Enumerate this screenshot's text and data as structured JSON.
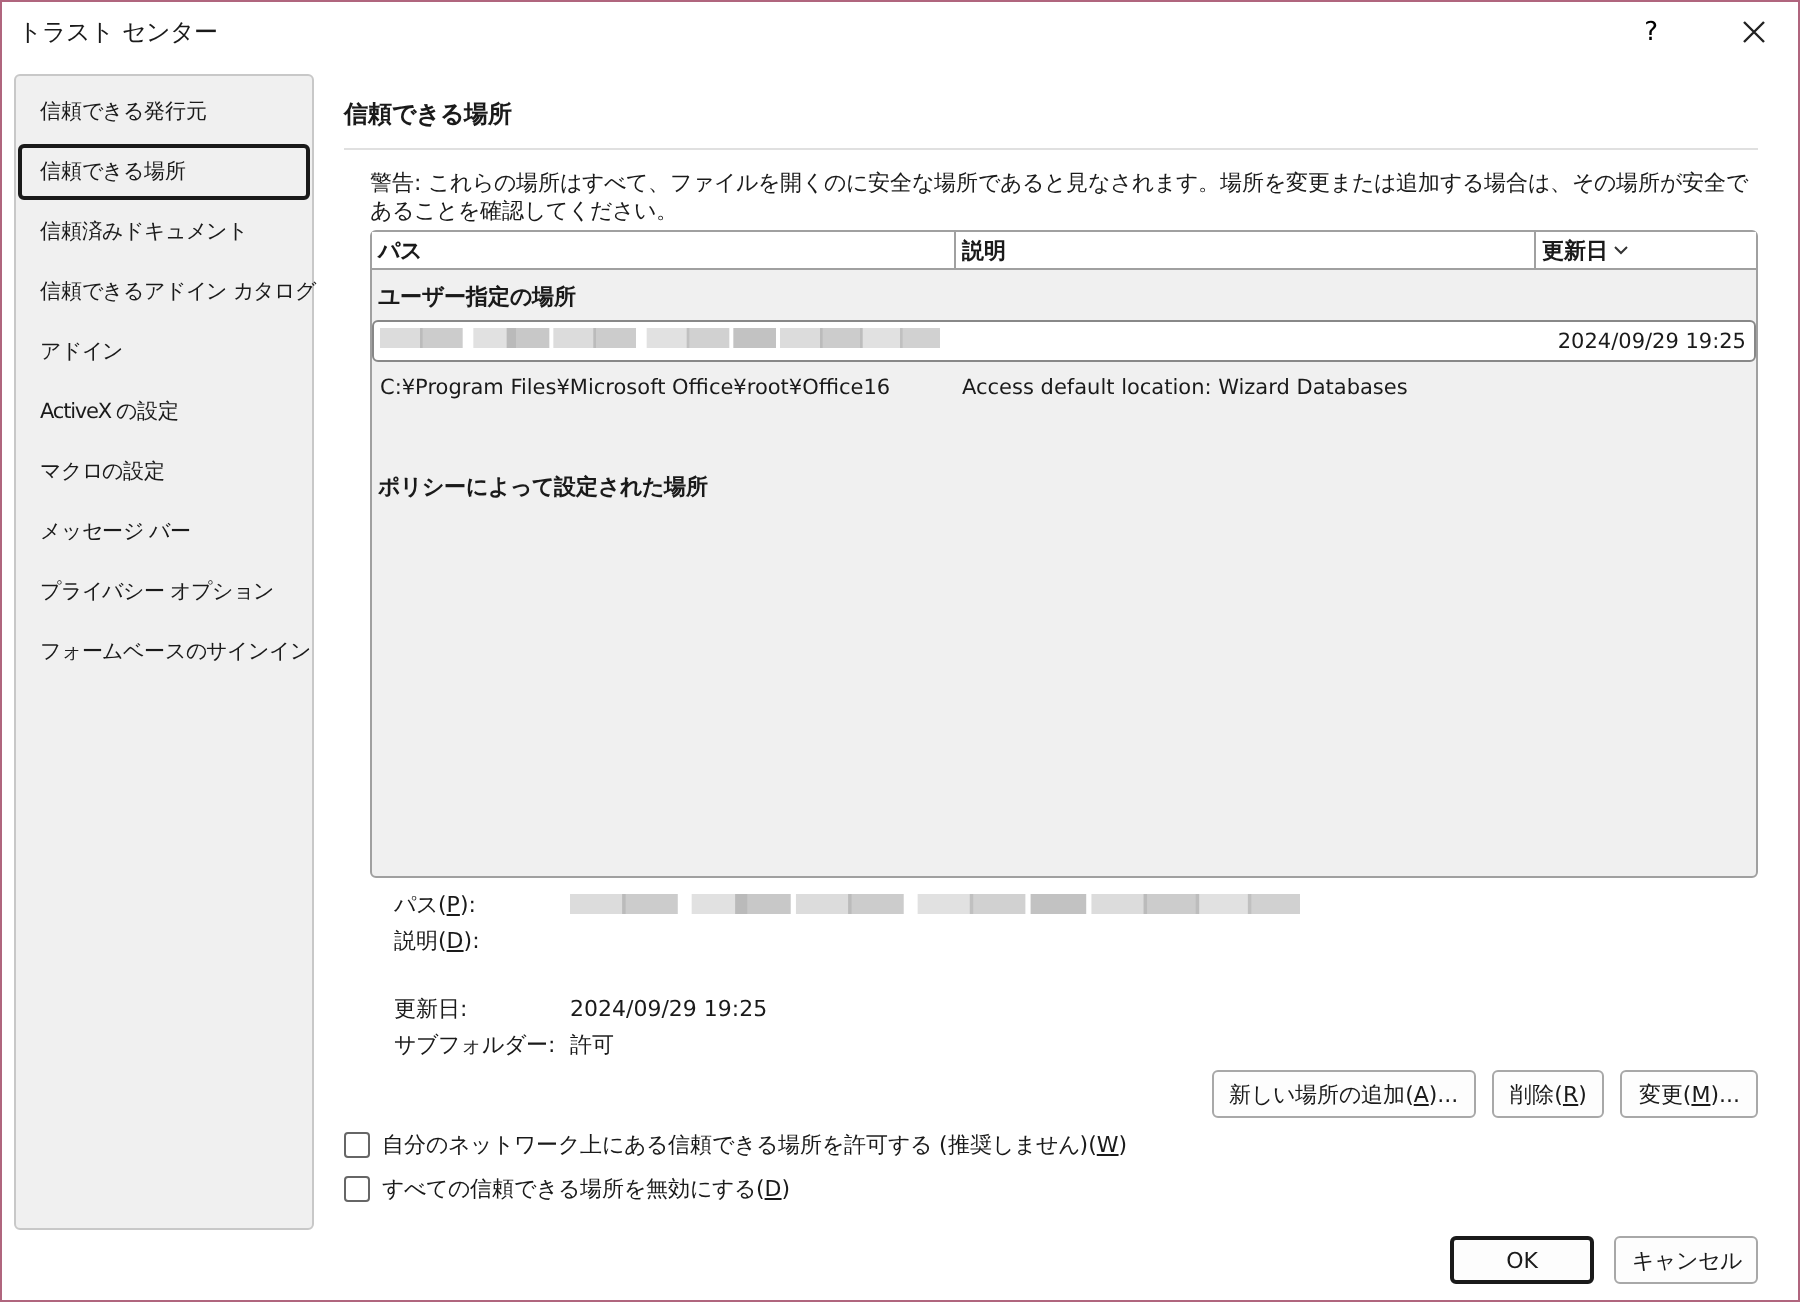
{
  "window": {
    "title": "トラスト センター",
    "help_button": "?"
  },
  "sidebar": {
    "items": [
      {
        "label": "信頼できる発行元",
        "selected": false
      },
      {
        "label": "信頼できる場所",
        "selected": true
      },
      {
        "label": "信頼済みドキュメント",
        "selected": false
      },
      {
        "label": "信頼できるアドイン カタログ",
        "selected": false
      },
      {
        "label": "アドイン",
        "selected": false
      },
      {
        "label": "ActiveX の設定",
        "selected": false
      },
      {
        "label": "マクロの設定",
        "selected": false
      },
      {
        "label": "メッセージ バー",
        "selected": false
      },
      {
        "label": "プライバシー オプション",
        "selected": false
      },
      {
        "label": "フォームベースのサインイン",
        "selected": false
      }
    ]
  },
  "section": {
    "title": "信頼できる場所",
    "warning": "警告: これらの場所はすべて、ファイルを開くのに安全な場所であると見なされます。場所を変更または追加する場合は、その場所が安全であることを確認してください。"
  },
  "table": {
    "columns": [
      {
        "label": "パス",
        "sorted": false
      },
      {
        "label": "説明",
        "sorted": false
      },
      {
        "label": "更新日",
        "sorted": true
      }
    ],
    "rows": [
      {
        "kind": "group",
        "label": "ユーザー指定の場所"
      },
      {
        "kind": "location",
        "redacted": true,
        "date": "2024/09/29 19:25",
        "selected": true
      },
      {
        "kind": "location",
        "redacted": false,
        "path": "C:¥Program Files¥Microsoft Office¥root¥Office16",
        "description": "Access default location: Wizard Databases",
        "selected": false
      },
      {
        "kind": "spacer"
      },
      {
        "kind": "group",
        "label": "ポリシーによって設定された場所"
      }
    ]
  },
  "details": [
    {
      "before": "パス(",
      "key": "P",
      "after": "):",
      "redacted": true
    },
    {
      "before": "説明(",
      "key": "D",
      "after": "):",
      "redacted": false
    },
    {
      "kind": "gap"
    },
    {
      "before": "更新日:",
      "value": "2024/09/29 19:25",
      "redacted": false
    },
    {
      "before": "サブフォルダー:",
      "value": "許可",
      "redacted": false
    }
  ],
  "buttons": [
    {
      "before": "新しい場所の追加(",
      "key": "A",
      "after": ")..."
    },
    {
      "before": "削除(",
      "key": "R",
      "after": ")"
    },
    {
      "before": "変更(",
      "key": "M",
      "after": ")..."
    }
  ],
  "checkboxes": [
    {
      "before": "自分のネットワーク上にある信頼できる場所を許可する (推奨しません)(",
      "key": "W",
      "after": ")",
      "checked": false
    },
    {
      "before": "すべての信頼できる場所を無効にする(",
      "key": "D",
      "after": ")",
      "checked": false
    }
  ],
  "dialog_buttons": [
    {
      "label": "OK",
      "default": true
    },
    {
      "label": "キャンセル",
      "default": false
    }
  ]
}
